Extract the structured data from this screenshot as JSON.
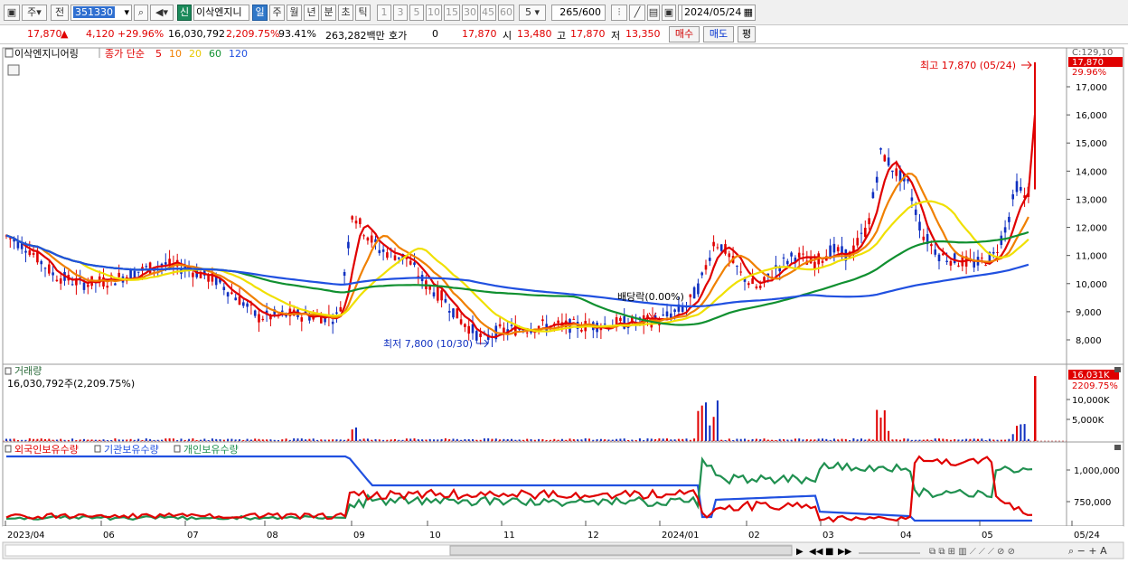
{
  "toolbar": {
    "mode": "주",
    "prev": "전",
    "code": "351330",
    "name": "이삭엔지니",
    "shin": "신",
    "periods": [
      "일",
      "주",
      "월",
      "년",
      "분",
      "초",
      "틱"
    ],
    "active_period": "일",
    "nums": [
      "1",
      "3",
      "5",
      "10",
      "15",
      "30",
      "45",
      "60"
    ],
    "count": "5",
    "range": "265",
    "range_total": "/600",
    "date": "2024/05/24"
  },
  "quote": {
    "price": "17,870",
    "change": "4,120",
    "change_pct": "+29.96%",
    "volume": "16,030,792",
    "vol_ratio": "2,209.75%",
    "turnover_ratio": "93.41%",
    "amount": "263,282백만",
    "hoga_label": "호가",
    "hoga_value": "0",
    "ask": "17,870",
    "open_label": "시",
    "open": "13,480",
    "high_label": "고",
    "high": "17,870",
    "low_label": "저",
    "low": "13,350",
    "buy_btn": "매수",
    "sell_btn": "매도",
    "avg_btn": "평"
  },
  "legend": {
    "name": "이삭엔지니어링",
    "ma_title": "종가 단순",
    "ma": [
      {
        "p": "5",
        "color": "#e00000"
      },
      {
        "p": "10",
        "color": "#f08000"
      },
      {
        "p": "20",
        "color": "#e8c800"
      },
      {
        "p": "60",
        "color": "#109030"
      },
      {
        "p": "120",
        "color": "#2050e0"
      }
    ]
  },
  "price_axis": {
    "ticks": [
      "17,000",
      "16,000",
      "15,000",
      "14,000",
      "13,000",
      "12,000",
      "11,000",
      "10,000",
      "9,000",
      "8,000"
    ],
    "top_label": "C:129,10",
    "cur_price": "17,870",
    "cur_pct": "29.96%"
  },
  "annotations": {
    "high": "최고 17,870 (05/24)",
    "low": "최저 7,800 (10/30)",
    "dividend": "배당락(0.00%)"
  },
  "volume": {
    "title": "거래량",
    "value": "16,030,792주(2,209.75%)",
    "ticks": [
      "10,000K",
      "5,000K"
    ],
    "cur": "16,031K",
    "cur_pct": "2209.75%"
  },
  "holders": {
    "series": [
      "외국인보유수량",
      "기관보유수량",
      "개인보유수량"
    ],
    "colors": [
      "#e00000",
      "#2050e0",
      "#209050"
    ],
    "ticks": [
      "1,000,000",
      "750,000"
    ]
  },
  "x_axis": [
    "2023/04",
    "06",
    "07",
    "08",
    "09",
    "10",
    "11",
    "12",
    "2024/01",
    "02",
    "03",
    "04",
    "05",
    "05/24"
  ]
}
